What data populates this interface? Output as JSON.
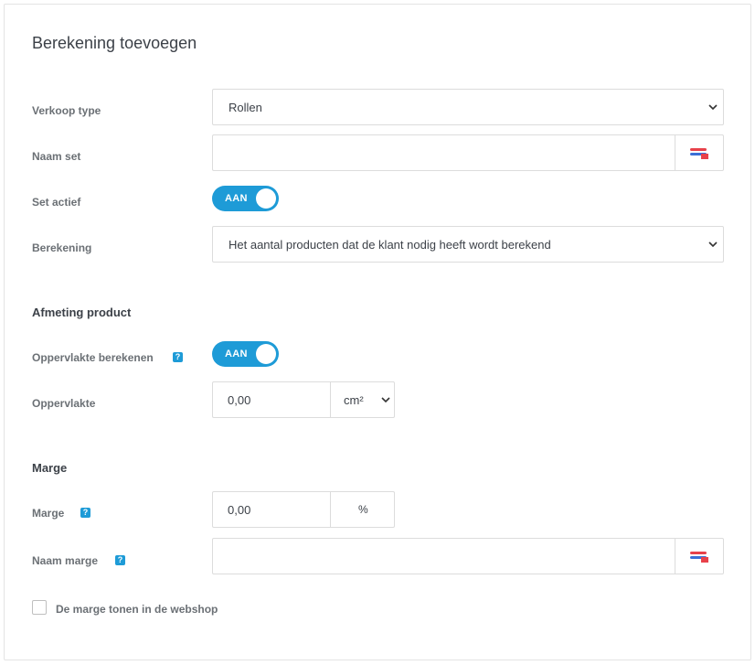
{
  "form": {
    "title": "Berekening toevoegen",
    "verkoop_type": {
      "label": "Verkoop type",
      "value": "Rollen"
    },
    "naam_set": {
      "label": "Naam set",
      "value": ""
    },
    "set_actief": {
      "label": "Set actief",
      "toggle_text": "AAN",
      "on": true
    },
    "berekening": {
      "label": "Berekening",
      "value": "Het aantal producten dat de klant nodig heeft wordt berekend"
    }
  },
  "afmeting": {
    "heading": "Afmeting product",
    "oppervlakte_berekenen": {
      "label": "Oppervlakte berekenen",
      "toggle_text": "AAN",
      "on": true,
      "help": "?"
    },
    "oppervlakte": {
      "label": "Oppervlakte",
      "value": "0,00",
      "unit": "cm²"
    }
  },
  "marge": {
    "heading": "Marge",
    "marge": {
      "label": "Marge",
      "value": "0,00",
      "unit": "%",
      "help": "?"
    },
    "naam_marge": {
      "label": "Naam marge",
      "value": "",
      "help": "?"
    },
    "tonen": {
      "label": "De marge tonen in de webshop",
      "checked": false
    }
  },
  "colors": {
    "accent": "#1e9bd7",
    "flag_red": "#e8414a",
    "flag_blue": "#3b6fd6"
  },
  "icons": [
    "chevron-down-icon",
    "flag-icon",
    "help-icon"
  ]
}
